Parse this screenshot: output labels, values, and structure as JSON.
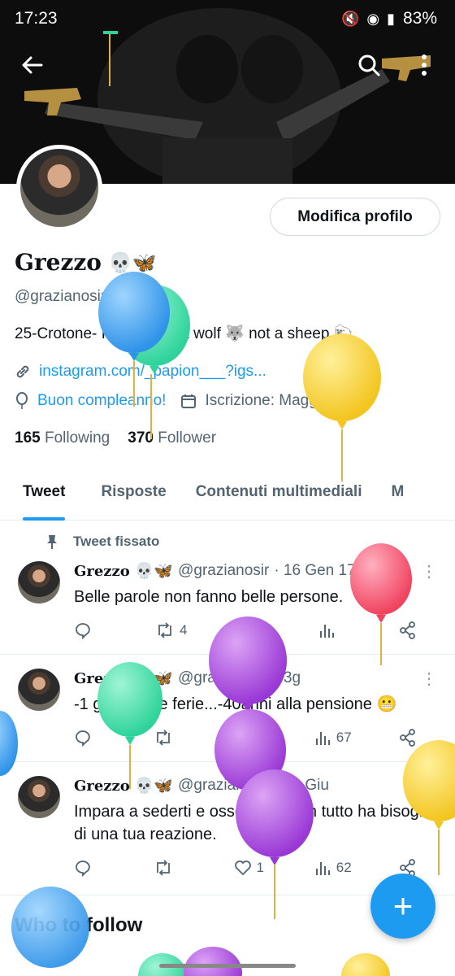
{
  "status": {
    "time": "17:23",
    "battery": "83%"
  },
  "header": {
    "back_label": "←",
    "search_label": "⌕",
    "more_label": "⋮"
  },
  "profile": {
    "name": "Grezzo",
    "name_emojis": "💀🦋",
    "handle": "@grazianosir",
    "bio": "25-Crotone- Italy 🇮🇹 Be a wolf 🐺 not a sheep 🐑",
    "link": "instagram.com/_papion___?igs...",
    "birthday": "Buon compleanno!",
    "joined": "Iscrizione: Maggio 2014",
    "following_count": "165",
    "following_label": "Following",
    "followers_count": "370",
    "followers_label": "Follower",
    "edit_button": "Modifica profilo"
  },
  "tabs": [
    "Tweet",
    "Risposte",
    "Contenuti multimediali",
    "M"
  ],
  "pinned_label": "Tweet fissato",
  "tweets": [
    {
      "name": "Grezzo",
      "emojis": "💀🦋",
      "handle": "@grazianosir",
      "date": "· 16 Gen 17",
      "text": "Belle parole non fanno belle persone.",
      "retweets": "4",
      "likes": "4",
      "views": ""
    },
    {
      "name": "Grezzo",
      "emojis": "💀🦋",
      "handle": "@grazianosir",
      "date": "· 3g",
      "text": "-1 giorno alle ferie...-40anni alla pensione 😬",
      "retweets": "",
      "likes": "2",
      "views": "67"
    },
    {
      "name": "Grezzo",
      "emojis": "💀🦋",
      "handle": "@grazianosir",
      "date": "· 14 Giu",
      "text": "Impara a sederti e osservare, non tutto ha bisogno di una tua reazione.",
      "retweets": "",
      "likes": "1",
      "views": "62"
    }
  ],
  "who_to_follow": "Who to follow",
  "fab_label": "+",
  "colors": {
    "accent": "#1d9bf0",
    "text": "#0f1419",
    "muted": "#536471"
  },
  "icons": [
    "back-arrow-icon",
    "search-icon",
    "more-icon",
    "link-icon",
    "balloon-icon",
    "calendar-icon",
    "pin-icon",
    "reply-icon",
    "retweet-icon",
    "like-icon",
    "views-icon",
    "share-icon",
    "compose-icon"
  ]
}
